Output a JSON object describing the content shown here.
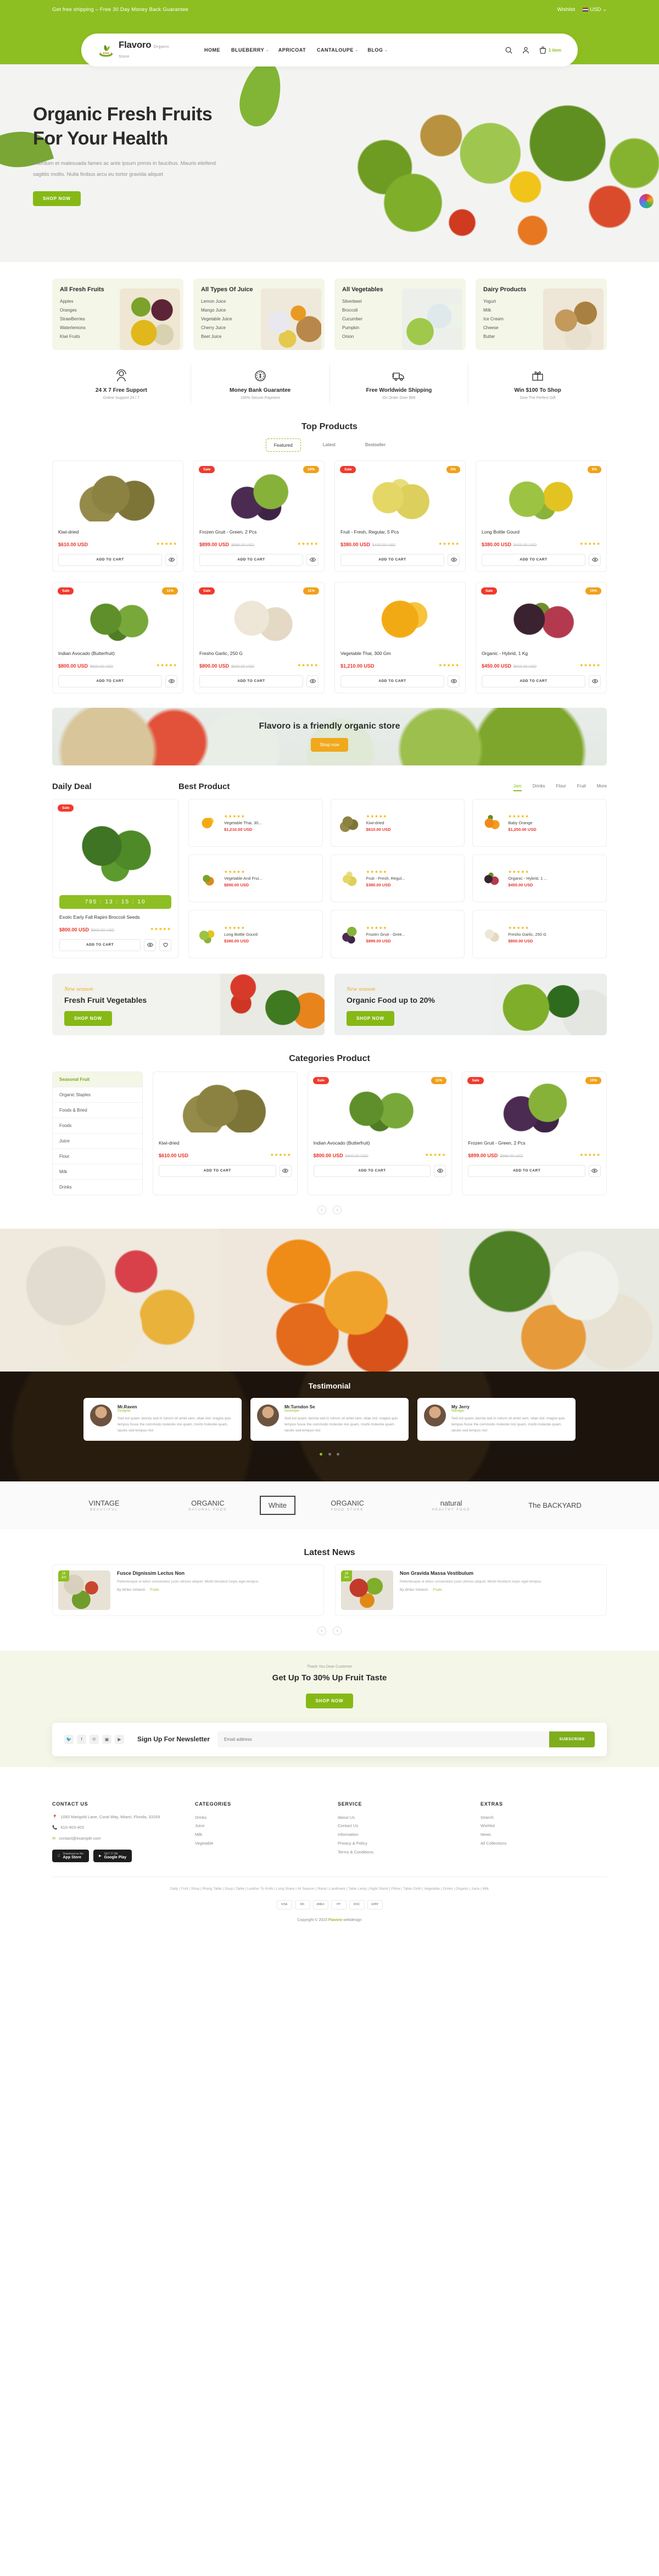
{
  "topbar": {
    "message": "Get free shipping – Free 30 Day Money Back Guarantee",
    "wishlist": "Wishlist",
    "currency": "USD",
    "currency_caret": "⌄"
  },
  "header": {
    "brand_name": "Flavoro",
    "brand_sub": "Organic Store",
    "nav": [
      {
        "label": "HOME",
        "caret": ""
      },
      {
        "label": "BLUEBERRY",
        "caret": "⌄"
      },
      {
        "label": "APRICOAT",
        "caret": ""
      },
      {
        "label": "CANTALOUPE",
        "caret": "⌄"
      },
      {
        "label": "BLOG",
        "caret": "⌄"
      }
    ],
    "cart_count": "1 item"
  },
  "hero": {
    "title_line1": "Organic Fresh Fruits",
    "title_line2": "For Your Health",
    "paragraph": "Interdum et malesuada fames ac ante ipsum primis in faucibus. Mauris eleifend sagittis mollis. Nulla finibus arcu eu tortor gravida aliquet",
    "cta": "SHOP NOW"
  },
  "categories": [
    {
      "title": "All Fresh Fruits",
      "items": [
        "Apples",
        "Oranges",
        "StrawBerries",
        "Waterlemons",
        "Kiwi Fruits"
      ],
      "art": "t1"
    },
    {
      "title": "All Types Of Juice",
      "items": [
        "Lemon Juice",
        "Mango Juice",
        "Vegetable Juice",
        "Cherry Juice",
        "Beet Juice"
      ],
      "art": "t2"
    },
    {
      "title": "All Vegetables",
      "items": [
        "Silverbeet",
        "Broccoli",
        "Cucumber",
        "Pumpkin",
        "Onion"
      ],
      "art": "t3"
    },
    {
      "title": "Dairy Products",
      "items": [
        "Yogurt",
        "Milk",
        "Ice Cream",
        "Cheese",
        "Butter"
      ],
      "art": "t4"
    }
  ],
  "features": [
    {
      "icon": "headset-support-icon",
      "title": "24 X 7 Free Support",
      "sub": "Online Support 24 / 7"
    },
    {
      "icon": "coin-icon",
      "title": "Money Bank Guarantee",
      "sub": "100% Secure Payment"
    },
    {
      "icon": "truck-icon",
      "title": "Free Worldwide Shipping",
      "sub": "On Order Over $99"
    },
    {
      "icon": "gift-icon",
      "title": "Win $100 To Shop",
      "sub": "Give The Perfect Gift"
    }
  ],
  "top_products": {
    "title": "Top Products",
    "tabs": [
      {
        "label": "Featured",
        "active": true
      },
      {
        "label": "Latest",
        "active": false
      },
      {
        "label": "Bestseller",
        "active": false
      }
    ],
    "add_to_cart": "ADD TO CART",
    "stars": "★★★★★",
    "items": [
      {
        "name": "Kiwi-dried",
        "price": "$610.00 USD",
        "old": "",
        "sale": "",
        "off": "",
        "art": "f-kiwi"
      },
      {
        "name": "Frozen Gruit - Green, 2 Pcs",
        "price": "$899.00 USD",
        "old": "$999.00 USD",
        "sale": "Sale",
        "off": "10%",
        "art": "f-grape"
      },
      {
        "name": "Fruit - Fresh, Regular, 5 Pcs",
        "price": "$380.00 USD",
        "old": "$400.00 USD",
        "sale": "Sale",
        "off": "5%",
        "art": "f-pear"
      },
      {
        "name": "Long Bottle Gourd",
        "price": "$380.00 USD",
        "old": "$400.00 USD",
        "sale": "",
        "off": "5%",
        "art": "f-gourd"
      },
      {
        "name": "Indian Avocado (Butterfruit)",
        "price": "$800.00 USD",
        "old": "$900.00 USD",
        "sale": "Sale",
        "off": "11%",
        "art": "f-avocado"
      },
      {
        "name": "Fresho Garlic, 250 G",
        "price": "$800.00 USD",
        "old": "$900.00 USD",
        "sale": "Sale",
        "off": "11%",
        "art": "f-garlic"
      },
      {
        "name": "Vegetable Thai, 300 Gm",
        "price": "$1,210.00 USD",
        "old": "",
        "sale": "",
        "off": "",
        "art": "f-mango"
      },
      {
        "name": "Organic - Hybrid, 1 Kg",
        "price": "$450.00 USD",
        "old": "$500.00 USD",
        "sale": "Sale",
        "off": "10%",
        "art": "f-mangosteen"
      }
    ]
  },
  "promo_strip": {
    "title": "Flavoro is a friendly organic store",
    "cta": "Shop now"
  },
  "daily_deal": {
    "title": "Daily Deal",
    "best_title": "Best Product",
    "tabs": [
      {
        "label": "Jam",
        "active": true
      },
      {
        "label": "Drinks",
        "active": false
      },
      {
        "label": "Flour",
        "active": false
      },
      {
        "label": "Fruit",
        "active": false
      },
      {
        "label": "More",
        "active": false
      }
    ],
    "deal": {
      "badge": "Sale",
      "timer": "795 : 13 : 15 : 10",
      "name": "Exotic Early Fall Rapini Broccoli Seeds",
      "price": "$800.00 USD",
      "old": "$900.00 USD",
      "add_to_cart": "ADD TO CART"
    },
    "best": [
      {
        "name": "Vegetable Thai, 30...",
        "price": "$1,210.00 USD",
        "art": "f-mango"
      },
      {
        "name": "Kiwi-dried",
        "price": "$610.00 USD",
        "art": "f-kiwi"
      },
      {
        "name": "Baby Orange",
        "price": "$1,250.00 USD",
        "art": "f-orange"
      },
      {
        "name": "Vegetable And Frui...",
        "price": "$890.00 USD",
        "art": "f-mango3"
      },
      {
        "name": "Fruit - Fresh, Regul...",
        "price": "$380.00 USD",
        "art": "f-pear"
      },
      {
        "name": "Organic - Hybrid, 1 ...",
        "price": "$450.00 USD",
        "art": "f-mangosteen"
      },
      {
        "name": "Long Bottle Gourd",
        "price": "$380.00 USD",
        "art": "f-gourd"
      },
      {
        "name": "Frozen Gruit - Gree...",
        "price": "$899.00 USD",
        "art": "f-grape"
      },
      {
        "name": "Fresho Garlic, 250 G",
        "price": "$800.00 USD",
        "art": "f-garlic"
      }
    ]
  },
  "season_banners": [
    {
      "kicker": "New season",
      "title": "Fresh Fruit Vegetables",
      "cta": "SHOP NOW",
      "art": "sb-art1"
    },
    {
      "kicker": "New season",
      "title": "Organic Food up to 20%",
      "cta": "SHOP NOW",
      "art": "sb-art2"
    }
  ],
  "categories_product": {
    "title": "Categories Product",
    "sidebar": [
      "Seasonal Fruit",
      "Organic Staples",
      "Foods & Bried",
      "Foods",
      "Juice",
      "Flour",
      "Milk",
      "Drinks"
    ],
    "active_index": 0,
    "add_to_cart": "ADD TO CART",
    "items": [
      {
        "name": "Kiwi-dried",
        "price": "$610.00 USD",
        "old": "",
        "sale": "",
        "off": "",
        "art": "f-kiwi"
      },
      {
        "name": "Indian Avocado (Butterfruit)",
        "price": "$800.00 USD",
        "old": "$900.00 USD",
        "sale": "Sale",
        "off": "11%",
        "art": "f-avocado"
      },
      {
        "name": "Frozen Gruit - Green, 2 Pcs",
        "price": "$899.00 USD",
        "old": "$999.00 USD",
        "sale": "Sale",
        "off": "10%",
        "art": "f-grape"
      }
    ],
    "pager_prev": "‹",
    "pager_next": "›"
  },
  "testimonial": {
    "title": "Testimonial",
    "items": [
      {
        "name": "Mr.Raven",
        "role": "Designer",
        "text": "Sed est quam, lacinia sed in rutrum sit amet sem, vitae nisl. magna quis tempus fusce the commodo molestie nisl quam, morbi molestie quam, iaculis sed tempus nisl"
      },
      {
        "name": "Mr.Turndon Se",
        "role": "Developer",
        "text": "Sed est quam, lacinia sed in rutrum sit amet sem, vitae nisl. magna quis tempus fusce the commodo molestie nisl quam, morbi molestie quam, iaculis sed tempus nisl"
      },
      {
        "name": "My Jerry",
        "role": "Manager",
        "text": "Sed est quam, lacinia sed in rutrum sit amet sem, vitae nisl. magna quis tempus fusce the commodo molestie nisl quam, morbi molestie quam, iaculis sed tempus nisl"
      }
    ]
  },
  "brands": [
    {
      "name": "VINTAGE",
      "sub": "BEAUTIFUL"
    },
    {
      "name": "ORGANIC",
      "sub": "NATURAL FOOD"
    },
    {
      "name": "White",
      "sub": "",
      "boxed": true
    },
    {
      "name": "ORGANIC",
      "sub": "FOOD STORE"
    },
    {
      "name": "natural",
      "sub": "HEALTHY FOOD"
    },
    {
      "name": "The BACKYARD",
      "sub": ""
    }
  ],
  "news": {
    "title": "Latest News",
    "items": [
      {
        "date_day": "16",
        "date_mon": "Jun",
        "title": "Fusce Dignissim Lectus Non",
        "text": "Pellentesque ut tellus consectetur justo ultrices aliquet. Morbi tincidunt turpis eget tempus.",
        "author": "By Writer Infotech",
        "tag": "Fruits",
        "art": "nimg1"
      },
      {
        "date_day": "16",
        "date_mon": "Jun",
        "title": "Non Gravida Massa Vestibulum",
        "text": "Pellentesque ut tellus consectetur justo ultrices aliquet. Morbi tincidunt turpis eget tempus.",
        "author": "By Writer Infotech",
        "tag": "Fruits",
        "art": "nimg2"
      }
    ],
    "pager_prev": "‹",
    "pager_next": "›"
  },
  "cta": {
    "small": "Thank You Dear Customer",
    "title": "Get Up To 30% Up Fruit Taste",
    "button": "Shop Now"
  },
  "newsletter": {
    "heading": "Sign Up For Newsletter",
    "placeholder": "Email address",
    "value": "",
    "button": "SUBSCRIBE",
    "socials": [
      {
        "icon": "twitter-icon",
        "glyph": "🐦"
      },
      {
        "icon": "facebook-icon",
        "glyph": "f"
      },
      {
        "icon": "pinterest-icon",
        "glyph": "℗"
      },
      {
        "icon": "instagram-icon",
        "glyph": "▣"
      },
      {
        "icon": "youtube-icon",
        "glyph": "▶"
      }
    ]
  },
  "footer": {
    "contact": {
      "heading": "CONTACT US",
      "address": "1093 Marigold Lane, Coral Way, Miami, Florida, 33169",
      "phone": "610-403-403",
      "email": "contact@example.com"
    },
    "categories": {
      "heading": "CATEGORIES",
      "items": [
        "Drinks",
        "Juice",
        "Milk",
        "Vegetable"
      ]
    },
    "service": {
      "heading": "SERVICE",
      "items": [
        "About Us",
        "Contact Us",
        "Information",
        "Privacy & Policy",
        "Terms & Conditions"
      ]
    },
    "extras": {
      "heading": "EXTRAS",
      "items": [
        "Search",
        "Wishlist",
        "News",
        "All Collections"
      ]
    },
    "stores": [
      {
        "top": "Download on the",
        "name": "App Store"
      },
      {
        "top": "GET IT ON",
        "name": "Google Play"
      }
    ],
    "tags": "Daily  |  Fruit  |  Shop  |  Rising Table  |  Soup  |  Table  |  Leather To Knife  |  Long Share  |  All Season  |  Stand  |  Landmark  |  Table Lamp  |  Night Stand  |  Pillow  |  Table Cloth  |  Vegetable  |  Drinks  |  Organic  |  Juice  |  Milk",
    "payments": [
      "VISA",
      "MC",
      "AMEX",
      "PP",
      "DISC",
      "GPAY"
    ],
    "copyright_pre": "Copyright © 2023 ",
    "copyright_brand": "Flavoro",
    "copyright_post": " webdesign"
  }
}
